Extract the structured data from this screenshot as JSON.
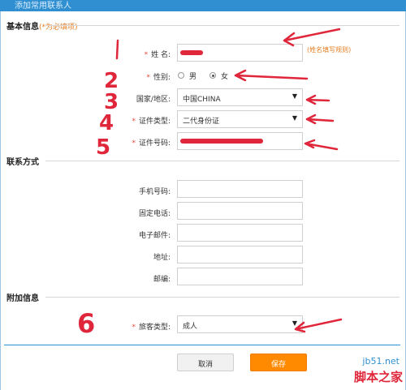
{
  "window": {
    "title": "添加常用联系人"
  },
  "sections": {
    "basic": {
      "title": "基本信息",
      "note": "(*为必填项)"
    },
    "contact": {
      "title": "联系方式"
    },
    "extra": {
      "title": "附加信息"
    }
  },
  "basic": {
    "name_label": "姓 名:",
    "name_hint": "(姓名填写规则)",
    "gender_label": "性别:",
    "gender_male": "男",
    "gender_female": "女",
    "country_label": "国家/地区:",
    "country_value": "中国CHINA",
    "idtype_label": "证件类型:",
    "idtype_value": "二代身份证",
    "idnum_label": "证件号码:"
  },
  "contact": {
    "mobile_label": "手机号码:",
    "phone_label": "固定电话:",
    "email_label": "电子邮件:",
    "address_label": "地址:",
    "zip_label": "邮编:"
  },
  "extra": {
    "passenger_label": "旅客类型:",
    "passenger_value": "成人"
  },
  "buttons": {
    "cancel": "取消",
    "save": "保存"
  },
  "required_mark": "*",
  "arrow_glyph": "▼",
  "annotations": [
    "1",
    "2",
    "3",
    "4",
    "5",
    "6"
  ],
  "watermark": {
    "site": "jb51.net",
    "name": "脚本之家"
  },
  "colors": {
    "accent": "#2f8fd0",
    "required": "#e74c3c",
    "save": "#ff8a00",
    "annotation": "#e0263a"
  }
}
